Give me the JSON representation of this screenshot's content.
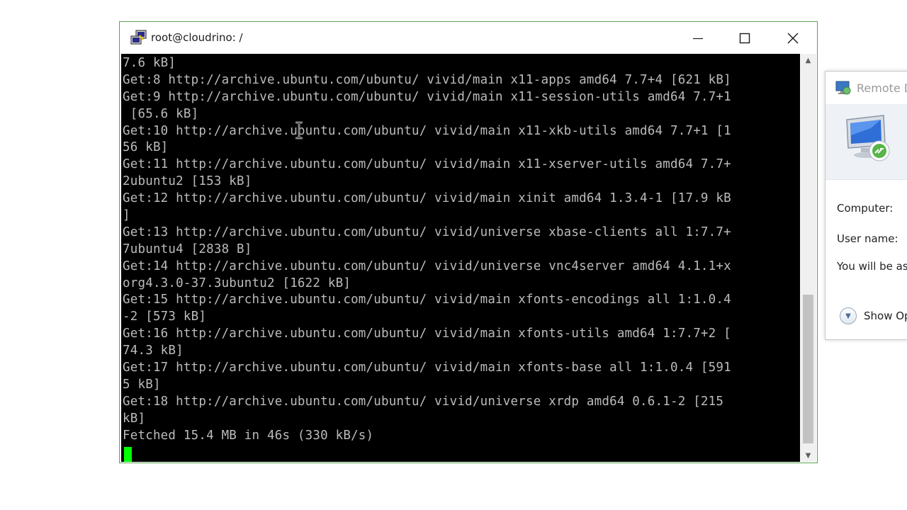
{
  "window": {
    "title": "root@cloudrino: /",
    "minimize_icon": "minimize-icon",
    "maximize_icon": "maximize-icon",
    "close_icon": "close-icon"
  },
  "terminal": {
    "lines": [
      "7.6 kB]",
      "Get:8 http://archive.ubuntu.com/ubuntu/ vivid/main x11-apps amd64 7.7+4 [621 kB]",
      "Get:9 http://archive.ubuntu.com/ubuntu/ vivid/main x11-session-utils amd64 7.7+1",
      " [65.6 kB]",
      "Get:10 http://archive.ubuntu.com/ubuntu/ vivid/main x11-xkb-utils amd64 7.7+1 [1",
      "56 kB]",
      "Get:11 http://archive.ubuntu.com/ubuntu/ vivid/main x11-xserver-utils amd64 7.7+",
      "2ubuntu2 [153 kB]",
      "Get:12 http://archive.ubuntu.com/ubuntu/ vivid/main xinit amd64 1.3.4-1 [17.9 kB",
      "]",
      "Get:13 http://archive.ubuntu.com/ubuntu/ vivid/universe xbase-clients all 1:7.7+",
      "7ubuntu4 [2838 B]",
      "Get:14 http://archive.ubuntu.com/ubuntu/ vivid/universe vnc4server amd64 4.1.1+x",
      "org4.3.0-37.3ubuntu2 [1622 kB]",
      "Get:15 http://archive.ubuntu.com/ubuntu/ vivid/main xfonts-encodings all 1:1.0.4",
      "-2 [573 kB]",
      "Get:16 http://archive.ubuntu.com/ubuntu/ vivid/main xfonts-utils amd64 1:7.7+2 [",
      "74.3 kB]",
      "Get:17 http://archive.ubuntu.com/ubuntu/ vivid/main xfonts-base all 1:1.0.4 [591",
      "5 kB]",
      "Get:18 http://archive.ubuntu.com/ubuntu/ vivid/universe xrdp amd64 0.6.1-2 [215",
      "kB]",
      "Fetched 15.4 MB in 46s (330 kB/s)"
    ],
    "text_color": "#bbbbbb",
    "background": "#000000",
    "cursor_color": "#00ff00"
  },
  "remote_desktop": {
    "title": "Remote D",
    "computer_label": "Computer:",
    "username_label": "User name:",
    "info_text": "You will be ask",
    "options_label": "Show Op"
  },
  "colors": {
    "window_border": "#5aa44d"
  }
}
